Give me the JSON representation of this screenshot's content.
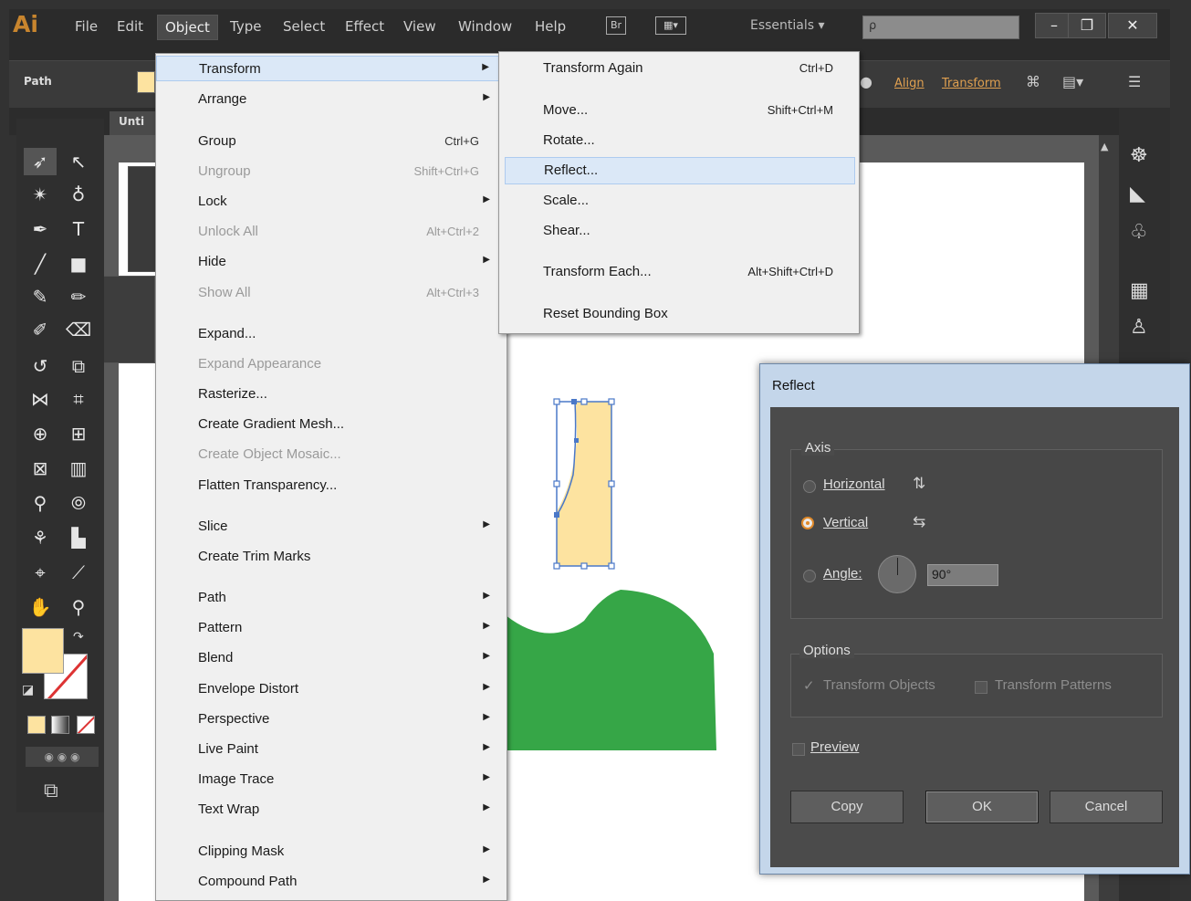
{
  "app": {
    "logo": "Ai",
    "menus": [
      "File",
      "Edit",
      "Object",
      "Type",
      "Select",
      "Effect",
      "View",
      "Window",
      "Help"
    ],
    "active_menu": "Object",
    "workspace": "Essentials",
    "search_glyph": "ρ",
    "window_controls": [
      "–",
      "❐",
      "✕"
    ]
  },
  "control_bar": {
    "selection_label": "Path",
    "align_link": "Align",
    "transform_link": "Transform"
  },
  "document": {
    "tab_label": "Unti"
  },
  "object_menu": {
    "items": [
      {
        "label": "Transform",
        "shortcut": "",
        "submenu": true,
        "disabled": false,
        "highlighted": true
      },
      {
        "label": "Arrange",
        "shortcut": "",
        "submenu": true,
        "disabled": false
      },
      {
        "label": "Group",
        "shortcut": "Ctrl+G",
        "submenu": false,
        "disabled": false
      },
      {
        "label": "Ungroup",
        "shortcut": "Shift+Ctrl+G",
        "submenu": false,
        "disabled": true
      },
      {
        "label": "Lock",
        "shortcut": "",
        "submenu": true,
        "disabled": false
      },
      {
        "label": "Unlock All",
        "shortcut": "Alt+Ctrl+2",
        "submenu": false,
        "disabled": true
      },
      {
        "label": "Hide",
        "shortcut": "",
        "submenu": true,
        "disabled": false
      },
      {
        "label": "Show All",
        "shortcut": "Alt+Ctrl+3",
        "submenu": false,
        "disabled": true
      },
      {
        "label": "Expand...",
        "shortcut": "",
        "submenu": false,
        "disabled": false
      },
      {
        "label": "Expand Appearance",
        "shortcut": "",
        "submenu": false,
        "disabled": true
      },
      {
        "label": "Rasterize...",
        "shortcut": "",
        "submenu": false,
        "disabled": false
      },
      {
        "label": "Create Gradient Mesh...",
        "shortcut": "",
        "submenu": false,
        "disabled": false
      },
      {
        "label": "Create Object Mosaic...",
        "shortcut": "",
        "submenu": false,
        "disabled": true
      },
      {
        "label": "Flatten Transparency...",
        "shortcut": "",
        "submenu": false,
        "disabled": false
      },
      {
        "label": "Slice",
        "shortcut": "",
        "submenu": true,
        "disabled": false
      },
      {
        "label": "Create Trim Marks",
        "shortcut": "",
        "submenu": false,
        "disabled": false
      },
      {
        "label": "Path",
        "shortcut": "",
        "submenu": true,
        "disabled": false
      },
      {
        "label": "Pattern",
        "shortcut": "",
        "submenu": true,
        "disabled": false
      },
      {
        "label": "Blend",
        "shortcut": "",
        "submenu": true,
        "disabled": false
      },
      {
        "label": "Envelope Distort",
        "shortcut": "",
        "submenu": true,
        "disabled": false
      },
      {
        "label": "Perspective",
        "shortcut": "",
        "submenu": true,
        "disabled": false
      },
      {
        "label": "Live Paint",
        "shortcut": "",
        "submenu": true,
        "disabled": false
      },
      {
        "label": "Image Trace",
        "shortcut": "",
        "submenu": true,
        "disabled": false
      },
      {
        "label": "Text Wrap",
        "shortcut": "",
        "submenu": true,
        "disabled": false
      },
      {
        "label": "Clipping Mask",
        "shortcut": "",
        "submenu": true,
        "disabled": false
      },
      {
        "label": "Compound Path",
        "shortcut": "",
        "submenu": true,
        "disabled": false
      }
    ]
  },
  "transform_submenu": {
    "items": [
      {
        "label": "Transform Again",
        "shortcut": "Ctrl+D"
      },
      {
        "label": "Move...",
        "shortcut": "Shift+Ctrl+M"
      },
      {
        "label": "Rotate...",
        "shortcut": ""
      },
      {
        "label": "Reflect...",
        "shortcut": "",
        "highlighted": true
      },
      {
        "label": "Scale...",
        "shortcut": ""
      },
      {
        "label": "Shear...",
        "shortcut": ""
      },
      {
        "label": "Transform Each...",
        "shortcut": "Alt+Shift+Ctrl+D"
      },
      {
        "label": "Reset Bounding Box",
        "shortcut": ""
      }
    ]
  },
  "reflect_dialog": {
    "title": "Reflect",
    "axis_group_label": "Axis",
    "horizontal_label": "Horizontal",
    "vertical_label": "Vertical",
    "angle_label": "Angle:",
    "angle_value": "90°",
    "selected_axis": "Vertical",
    "options_group_label": "Options",
    "transform_objects_label": "Transform Objects",
    "transform_objects_checked": true,
    "transform_patterns_label": "Transform Patterns",
    "transform_patterns_checked": false,
    "preview_label": "Preview",
    "preview_checked": false,
    "copy_button": "Copy",
    "ok_button": "OK",
    "cancel_button": "Cancel"
  },
  "colors": {
    "fill": "#fde3a0",
    "green_shape": "#36a647",
    "selection": "#4a78c8",
    "accent_orange": "#e08a2a"
  }
}
